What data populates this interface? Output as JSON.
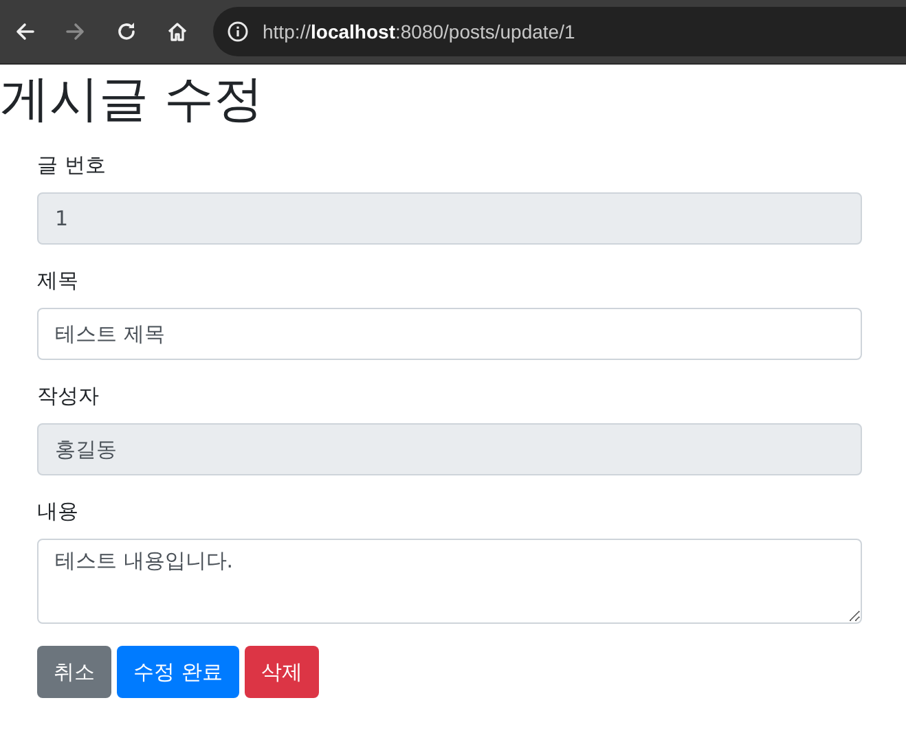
{
  "browser": {
    "nav_buttons": [
      {
        "kind": "back",
        "disabled": false
      },
      {
        "kind": "forward",
        "disabled": true
      },
      {
        "kind": "reload",
        "disabled": false
      },
      {
        "kind": "home",
        "disabled": false
      }
    ],
    "url": "http://**localhost**:8080/posts/update/1"
  },
  "title": "게시글 수정",
  "fields": [
    {
      "label": "글 번호",
      "kind": "input",
      "value": "1",
      "readonly": true
    },
    {
      "label": "제목",
      "kind": "input",
      "value": "테스트 제목",
      "readonly": false
    },
    {
      "label": "작성자",
      "kind": "input",
      "value": "홍길동",
      "readonly": true
    },
    {
      "label": "내용",
      "kind": "textarea",
      "value": "테스트 내용입니다.",
      "readonly": false
    }
  ],
  "buttons": [
    {
      "label": "취소",
      "kind": "secondary"
    },
    {
      "label": "수정 완료",
      "kind": "primary"
    },
    {
      "label": "삭제",
      "kind": "danger"
    }
  ]
}
